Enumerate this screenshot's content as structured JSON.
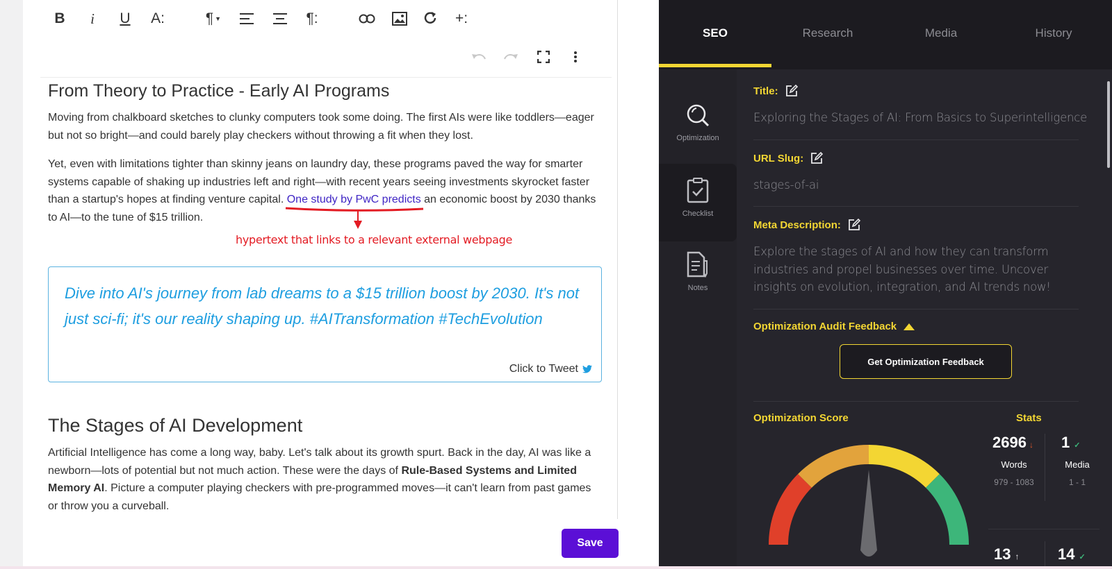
{
  "editor": {
    "toolbar": {
      "bold": "B",
      "italic": "i",
      "underline": "U",
      "font_size": "A:",
      "paragraph": "¶",
      "paragraph_more": "¶:",
      "insert_more": "+:"
    },
    "heading1": "From Theory to Practice - Early AI Programs",
    "para1": "Moving from chalkboard sketches to clunky computers took some doing. The first AIs were like toddlers—eager but not so bright—and could barely play checkers without throwing a fit when they lost.",
    "para2_before": "Yet, even with limitations tighter than skinny jeans on laundry day, these programs paved the way for smarter systems capable of shaking up industries left and right—with recent years seeing investments skyrocket faster than a startup's hopes at finding venture capital. ",
    "para2_link": "One study by PwC predicts",
    "para2_after": " an economic boost by 2030 thanks to AI—to the tune of $15 trillion.",
    "annotation": "hypertext that links to a relevant external webpage",
    "tweet": {
      "text": "Dive into AI's journey from lab dreams to a $15 trillion boost by 2030. It's not just sci-fi; it's our reality shaping up. #AITransformation #TechEvolution",
      "cta": "Click to Tweet"
    },
    "heading2": "The Stages of AI Development",
    "para3_before": "Artificial Intelligence has come a long way, baby. Let's talk about its growth spurt. Back in the day, AI was like a newborn—lots of potential but not much action. These were the days of ",
    "para3_bold": "Rule-Based Systems and Limited Memory AI",
    "para3_after": ". Picture a computer playing checkers with pre-programmed moves—it can't learn from past games or throw you a curveball.",
    "save_label": "Save"
  },
  "panel": {
    "tabs": [
      {
        "label": "SEO",
        "active": true
      },
      {
        "label": "Research",
        "active": false
      },
      {
        "label": "Media",
        "active": false
      },
      {
        "label": "History",
        "active": false
      }
    ],
    "sidenav": [
      {
        "label": "Optimization",
        "icon": "search-icon",
        "active": true
      },
      {
        "label": "Checklist",
        "icon": "clipboard-check-icon",
        "active": false
      },
      {
        "label": "Notes",
        "icon": "notes-icon",
        "active": false
      }
    ],
    "title_label": "Title:",
    "title_value": "Exploring the Stages of AI: From Basics to Superintelligence",
    "slug_label": "URL Slug:",
    "slug_value": "stages-of-ai",
    "meta_label": "Meta Description:",
    "meta_value": "Explore the stages of AI and how they can transform industries and propel businesses over time. Uncover insights on evolution, integration, and AI trends now!",
    "audit_label": "Optimization Audit Feedback",
    "feedback_button": "Get Optimization Feedback",
    "score_label": "Optimization Score",
    "stats_label": "Stats",
    "stats": {
      "words_value": "2696",
      "words_label": "Words",
      "words_range": "979 - 1083",
      "media_value": "1",
      "media_label": "Media",
      "media_range": "1 - 1",
      "third_value": "13",
      "fourth_value": "14"
    },
    "colors": {
      "accent": "#f3d633",
      "gauge_red": "#e0402a",
      "gauge_orange": "#e2a33c",
      "gauge_yellow": "#f3d633",
      "gauge_green": "#3db67a"
    }
  }
}
